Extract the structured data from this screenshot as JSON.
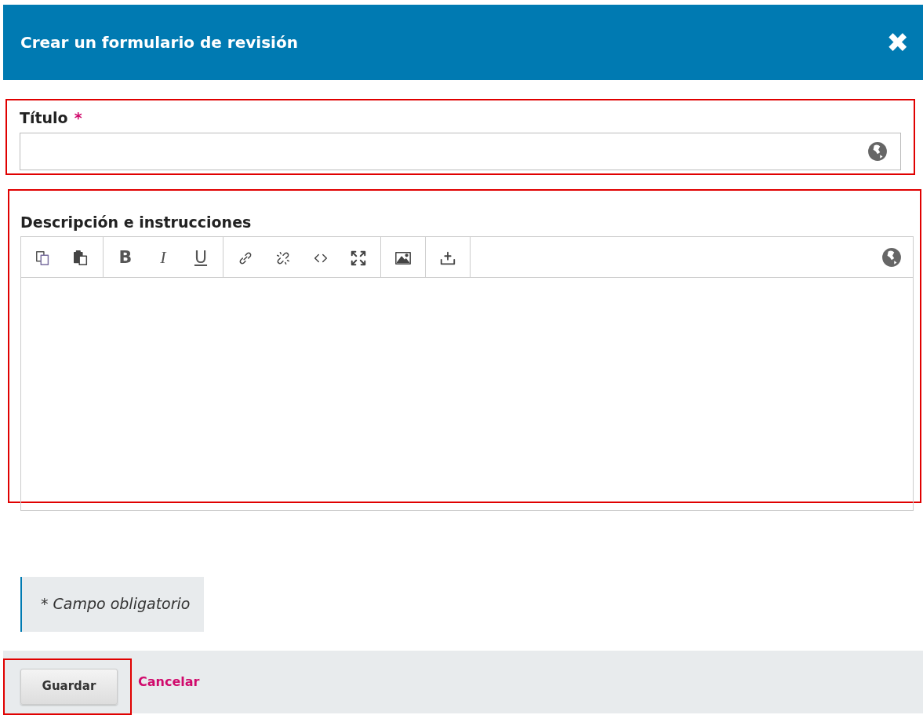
{
  "dialog": {
    "title": "Crear un formulario de revisión",
    "close_icon": "✖"
  },
  "title_field": {
    "label": "Título",
    "required_mark": "*",
    "highlighted": true
  },
  "description_field": {
    "label": "Descripción e instrucciones",
    "highlighted": true,
    "toolbar": [
      [
        {
          "kind": "copy"
        },
        {
          "kind": "paste"
        }
      ],
      [
        {
          "kind": "bold",
          "label": "B"
        },
        {
          "kind": "italic",
          "label": "I"
        },
        {
          "kind": "underline",
          "label": "U"
        }
      ],
      [
        {
          "kind": "link"
        },
        {
          "kind": "unlink"
        },
        {
          "kind": "code"
        },
        {
          "kind": "fullscreen"
        }
      ],
      [
        {
          "kind": "image"
        }
      ],
      [
        {
          "kind": "upload"
        }
      ]
    ]
  },
  "note": "* Campo obligatorio",
  "footer": {
    "save": {
      "label": "Guardar",
      "highlighted": true
    },
    "cancel": "Cancelar"
  }
}
